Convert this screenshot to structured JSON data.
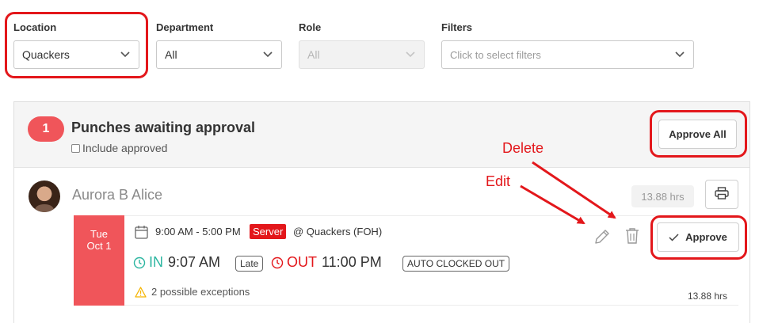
{
  "filters": {
    "location": {
      "label": "Location",
      "value": "Quackers"
    },
    "department": {
      "label": "Department",
      "value": "All"
    },
    "role": {
      "label": "Role",
      "value": "All"
    },
    "filters": {
      "label": "Filters",
      "placeholder": "Click to select filters"
    }
  },
  "panel": {
    "count": "1",
    "title": "Punches awaiting approval",
    "include_label": "Include approved",
    "approve_all_label": "Approve All"
  },
  "employee": {
    "name": "Aurora B Alice",
    "total_hours": "13.88 hrs"
  },
  "shift": {
    "day": "Tue",
    "date": "Oct 1",
    "time": "9:00 AM - 5:00 PM",
    "role": "Server",
    "location": "@ Quackers (FOH)",
    "in_label": "IN",
    "in_time": "9:07 AM",
    "late_tag": "Late",
    "out_label": "OUT",
    "out_time": "11:00 PM",
    "auto_tag": "AUTO CLOCKED OUT",
    "exceptions": "2 possible exceptions",
    "hours": "13.88 hrs",
    "approve_label": "Approve"
  },
  "annotations": {
    "delete": "Delete",
    "edit": "Edit"
  },
  "colors": {
    "accent_red": "#f0555a",
    "annotation_red": "#e3171b",
    "in_green": "#2bb5a0",
    "out_red": "#e3171b",
    "warning_yellow": "#f5b400"
  }
}
